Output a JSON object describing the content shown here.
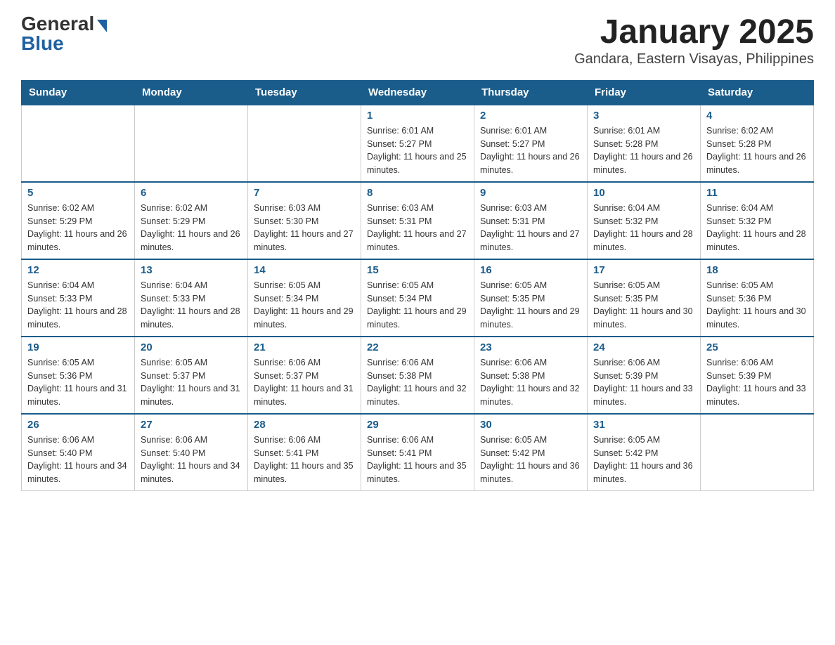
{
  "header": {
    "logo_general": "General",
    "logo_blue": "Blue",
    "title": "January 2025",
    "subtitle": "Gandara, Eastern Visayas, Philippines"
  },
  "calendar": {
    "days_of_week": [
      "Sunday",
      "Monday",
      "Tuesday",
      "Wednesday",
      "Thursday",
      "Friday",
      "Saturday"
    ],
    "weeks": [
      [
        {
          "day": "",
          "info": ""
        },
        {
          "day": "",
          "info": ""
        },
        {
          "day": "",
          "info": ""
        },
        {
          "day": "1",
          "info": "Sunrise: 6:01 AM\nSunset: 5:27 PM\nDaylight: 11 hours and 25 minutes."
        },
        {
          "day": "2",
          "info": "Sunrise: 6:01 AM\nSunset: 5:27 PM\nDaylight: 11 hours and 26 minutes."
        },
        {
          "day": "3",
          "info": "Sunrise: 6:01 AM\nSunset: 5:28 PM\nDaylight: 11 hours and 26 minutes."
        },
        {
          "day": "4",
          "info": "Sunrise: 6:02 AM\nSunset: 5:28 PM\nDaylight: 11 hours and 26 minutes."
        }
      ],
      [
        {
          "day": "5",
          "info": "Sunrise: 6:02 AM\nSunset: 5:29 PM\nDaylight: 11 hours and 26 minutes."
        },
        {
          "day": "6",
          "info": "Sunrise: 6:02 AM\nSunset: 5:29 PM\nDaylight: 11 hours and 26 minutes."
        },
        {
          "day": "7",
          "info": "Sunrise: 6:03 AM\nSunset: 5:30 PM\nDaylight: 11 hours and 27 minutes."
        },
        {
          "day": "8",
          "info": "Sunrise: 6:03 AM\nSunset: 5:31 PM\nDaylight: 11 hours and 27 minutes."
        },
        {
          "day": "9",
          "info": "Sunrise: 6:03 AM\nSunset: 5:31 PM\nDaylight: 11 hours and 27 minutes."
        },
        {
          "day": "10",
          "info": "Sunrise: 6:04 AM\nSunset: 5:32 PM\nDaylight: 11 hours and 28 minutes."
        },
        {
          "day": "11",
          "info": "Sunrise: 6:04 AM\nSunset: 5:32 PM\nDaylight: 11 hours and 28 minutes."
        }
      ],
      [
        {
          "day": "12",
          "info": "Sunrise: 6:04 AM\nSunset: 5:33 PM\nDaylight: 11 hours and 28 minutes."
        },
        {
          "day": "13",
          "info": "Sunrise: 6:04 AM\nSunset: 5:33 PM\nDaylight: 11 hours and 28 minutes."
        },
        {
          "day": "14",
          "info": "Sunrise: 6:05 AM\nSunset: 5:34 PM\nDaylight: 11 hours and 29 minutes."
        },
        {
          "day": "15",
          "info": "Sunrise: 6:05 AM\nSunset: 5:34 PM\nDaylight: 11 hours and 29 minutes."
        },
        {
          "day": "16",
          "info": "Sunrise: 6:05 AM\nSunset: 5:35 PM\nDaylight: 11 hours and 29 minutes."
        },
        {
          "day": "17",
          "info": "Sunrise: 6:05 AM\nSunset: 5:35 PM\nDaylight: 11 hours and 30 minutes."
        },
        {
          "day": "18",
          "info": "Sunrise: 6:05 AM\nSunset: 5:36 PM\nDaylight: 11 hours and 30 minutes."
        }
      ],
      [
        {
          "day": "19",
          "info": "Sunrise: 6:05 AM\nSunset: 5:36 PM\nDaylight: 11 hours and 31 minutes."
        },
        {
          "day": "20",
          "info": "Sunrise: 6:05 AM\nSunset: 5:37 PM\nDaylight: 11 hours and 31 minutes."
        },
        {
          "day": "21",
          "info": "Sunrise: 6:06 AM\nSunset: 5:37 PM\nDaylight: 11 hours and 31 minutes."
        },
        {
          "day": "22",
          "info": "Sunrise: 6:06 AM\nSunset: 5:38 PM\nDaylight: 11 hours and 32 minutes."
        },
        {
          "day": "23",
          "info": "Sunrise: 6:06 AM\nSunset: 5:38 PM\nDaylight: 11 hours and 32 minutes."
        },
        {
          "day": "24",
          "info": "Sunrise: 6:06 AM\nSunset: 5:39 PM\nDaylight: 11 hours and 33 minutes."
        },
        {
          "day": "25",
          "info": "Sunrise: 6:06 AM\nSunset: 5:39 PM\nDaylight: 11 hours and 33 minutes."
        }
      ],
      [
        {
          "day": "26",
          "info": "Sunrise: 6:06 AM\nSunset: 5:40 PM\nDaylight: 11 hours and 34 minutes."
        },
        {
          "day": "27",
          "info": "Sunrise: 6:06 AM\nSunset: 5:40 PM\nDaylight: 11 hours and 34 minutes."
        },
        {
          "day": "28",
          "info": "Sunrise: 6:06 AM\nSunset: 5:41 PM\nDaylight: 11 hours and 35 minutes."
        },
        {
          "day": "29",
          "info": "Sunrise: 6:06 AM\nSunset: 5:41 PM\nDaylight: 11 hours and 35 minutes."
        },
        {
          "day": "30",
          "info": "Sunrise: 6:05 AM\nSunset: 5:42 PM\nDaylight: 11 hours and 36 minutes."
        },
        {
          "day": "31",
          "info": "Sunrise: 6:05 AM\nSunset: 5:42 PM\nDaylight: 11 hours and 36 minutes."
        },
        {
          "day": "",
          "info": ""
        }
      ]
    ]
  }
}
